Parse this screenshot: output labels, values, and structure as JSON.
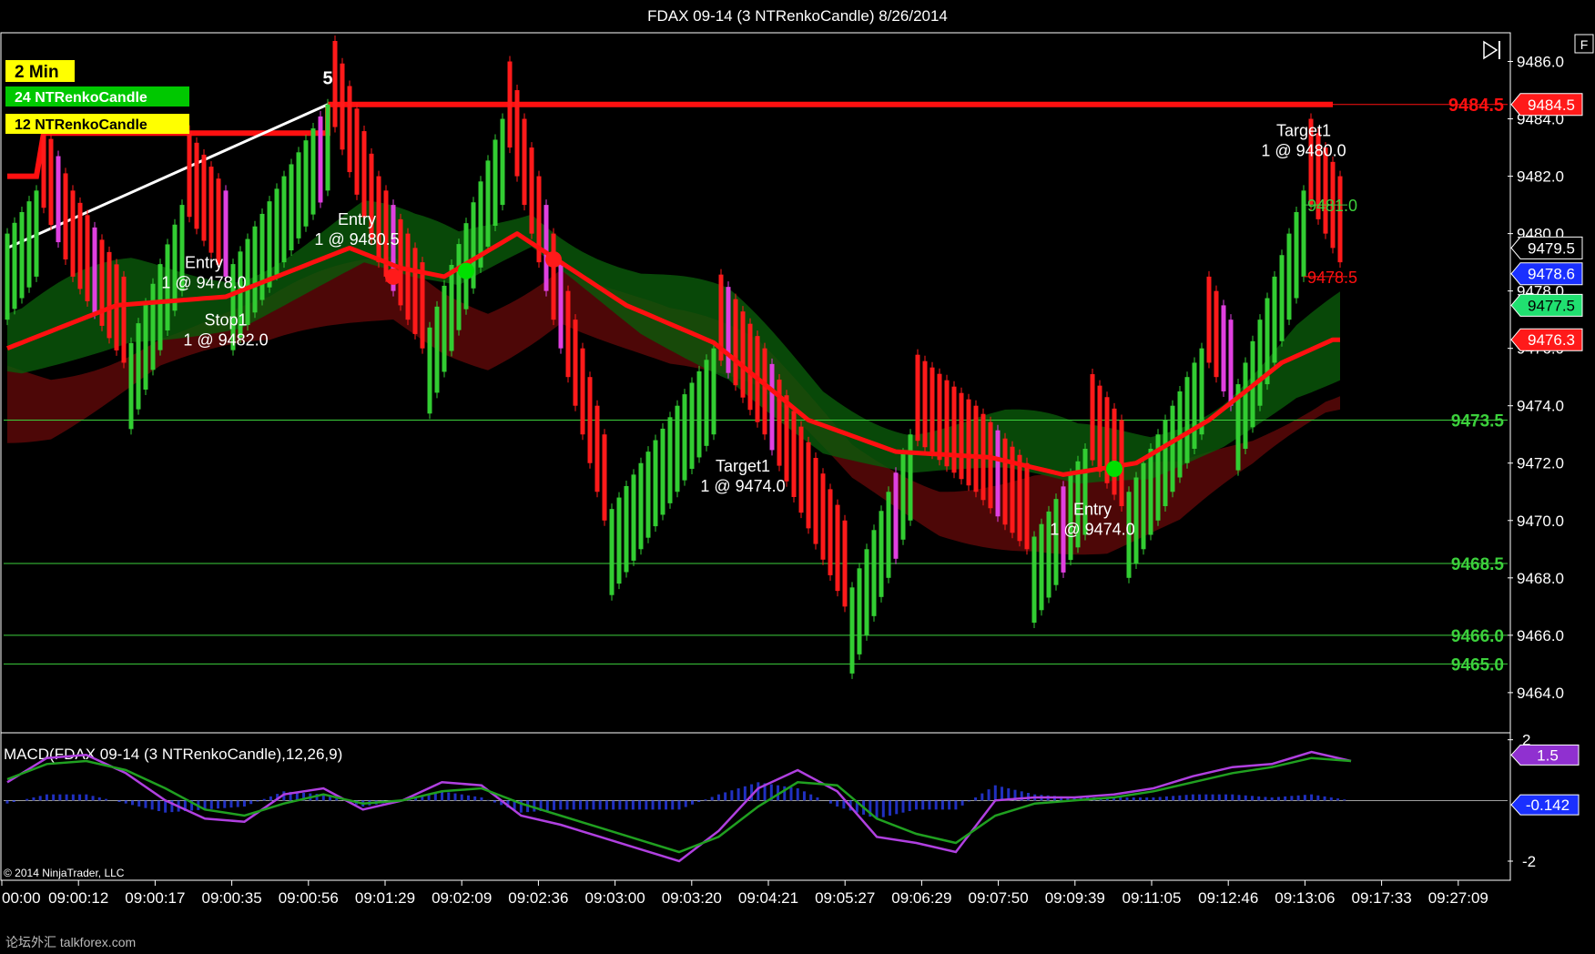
{
  "window": {
    "title": "FDAX 09-14 (3 NTRenkoCandle)  8/26/2014",
    "corner_button": "F",
    "copyright": "© 2014 NinjaTrader, LLC",
    "watermark": "论坛外汇 talkforex.com"
  },
  "legend_boxes": [
    {
      "label": "2 Min",
      "color": "#ffff00"
    },
    {
      "label": "24 NTRenkoCandle",
      "color": "#00c800"
    },
    {
      "label": "12 NTRenkoCandle",
      "color": "#ffff00"
    }
  ],
  "colors": {
    "bull_bar": "#32cd32",
    "bear_bar": "#ff1a1a",
    "magenta_bar": "#e040e0",
    "ma_red": "#ff1010",
    "cloud_green": "#0a5a0a",
    "cloud_red": "#5a0808",
    "macd_line": "#b040e0",
    "signal_line": "#20a020",
    "histogram": "#2030c0",
    "level_green": "#3cd03c"
  },
  "chart_data": [
    {
      "type": "candlestick",
      "title": "FDAX 09-14 (3 NTRenkoCandle)  8/26/2014",
      "ylim": [
        9462.6,
        9487.0
      ],
      "y_ticks": [
        "9486.0",
        "9484.0",
        "9482.0",
        "9480.0",
        "9478.0",
        "9476.0",
        "9474.0",
        "9472.0",
        "9470.0",
        "9468.0",
        "9466.0",
        "9464.0"
      ],
      "x_tick_labels": [
        "00:00",
        "09:00:12",
        "09:00:17",
        "09:00:35",
        "09:00:56",
        "09:01:29",
        "09:02:09",
        "09:02:36",
        "09:03:00",
        "09:03:20",
        "09:04:21",
        "09:05:27",
        "09:06:29",
        "09:07:50",
        "09:09:39",
        "09:11:05",
        "09:12:46",
        "09:13:06",
        "09:17:33",
        "09:27:09"
      ],
      "price_path": [
        {
          "x": 0,
          "y": 9480.0
        },
        {
          "x": 4,
          "y": 9481.5
        },
        {
          "x": 9,
          "y": 9478.5
        },
        {
          "x": 16,
          "y": 9475.5
        },
        {
          "x": 24,
          "y": 9481.0
        },
        {
          "x": 30,
          "y": 9478.5
        },
        {
          "x": 38,
          "y": 9482.0
        },
        {
          "x": 44,
          "y": 9484.5
        },
        {
          "x": 51,
          "y": 9479.0
        },
        {
          "x": 57,
          "y": 9476.0
        },
        {
          "x": 68,
          "y": 9484.0
        },
        {
          "x": 82,
          "y": 9470.0
        },
        {
          "x": 97,
          "y": 9476.0
        },
        {
          "x": 104,
          "y": 9473.0
        },
        {
          "x": 115,
          "y": 9467.0
        },
        {
          "x": 124,
          "y": 9473.0
        },
        {
          "x": 133,
          "y": 9471.0
        },
        {
          "x": 140,
          "y": 9469.0
        },
        {
          "x": 148,
          "y": 9472.5
        },
        {
          "x": 153,
          "y": 9470.5
        },
        {
          "x": 164,
          "y": 9476.0
        },
        {
          "x": 168,
          "y": 9474.0
        },
        {
          "x": 178,
          "y": 9481.5
        },
        {
          "x": 183,
          "y": 9479.0
        }
      ],
      "moving_average": [
        {
          "x": 0,
          "y": 9476.0
        },
        {
          "x": 15,
          "y": 9477.5
        },
        {
          "x": 30,
          "y": 9477.8
        },
        {
          "x": 47,
          "y": 9479.5
        },
        {
          "x": 54,
          "y": 9478.8
        },
        {
          "x": 60,
          "y": 9478.5
        },
        {
          "x": 70,
          "y": 9480.0
        },
        {
          "x": 85,
          "y": 9477.5
        },
        {
          "x": 97,
          "y": 9476.2
        },
        {
          "x": 110,
          "y": 9473.5
        },
        {
          "x": 122,
          "y": 9472.4
        },
        {
          "x": 135,
          "y": 9472.2
        },
        {
          "x": 145,
          "y": 9471.6
        },
        {
          "x": 155,
          "y": 9472.0
        },
        {
          "x": 165,
          "y": 9473.5
        },
        {
          "x": 175,
          "y": 9475.5
        },
        {
          "x": 182,
          "y": 9476.3
        }
      ],
      "trend_line": [
        {
          "x": 0,
          "y": 9479.5
        },
        {
          "x": 44,
          "y": 9484.5
        }
      ],
      "resistance_line": {
        "y": 9484.5,
        "x_from": 44,
        "x_to": 182
      },
      "step_line": [
        {
          "x": 0,
          "y": 9482.0
        },
        {
          "x": 4,
          "y": 9482.0
        },
        {
          "x": 5,
          "y": 9483.5
        },
        {
          "x": 44,
          "y": 9483.5
        },
        {
          "x": 44,
          "y": 9484.5
        }
      ],
      "swing_dots": [
        {
          "x": 53,
          "y": 9478.5,
          "color": "#ff1a1a"
        },
        {
          "x": 63,
          "y": 9478.7,
          "color": "#00e000"
        },
        {
          "x": 75,
          "y": 9479.1,
          "color": "#ff1a1a"
        },
        {
          "x": 152,
          "y": 9471.8,
          "color": "#00e000"
        }
      ],
      "levels": [
        {
          "price": 9473.5,
          "label": "9473.5"
        },
        {
          "price": 9468.5,
          "label": "9468.5"
        },
        {
          "price": 9466.0,
          "label": "9466.0"
        },
        {
          "price": 9465.0,
          "label": "9465.0"
        }
      ],
      "resistance_label": "9484.5",
      "axis_markers": [
        {
          "label": "9484.5",
          "price": 9484.5,
          "bg": "#ff1a1a",
          "fg": "#ffffff"
        },
        {
          "label": "9479.5",
          "price": 9479.5,
          "bg": "#000000",
          "fg": "#ffffff"
        },
        {
          "label": "9478.6",
          "price": 9478.6,
          "bg": "#1a30ff",
          "fg": "#ffffff"
        },
        {
          "label": "9477.5",
          "price": 9477.5,
          "bg": "#20e070",
          "fg": "#000000"
        },
        {
          "label": "9476.3",
          "price": 9476.3,
          "bg": "#ff1a1a",
          "fg": "#ffffff"
        }
      ],
      "target_level": {
        "label": "9481.0",
        "price": 9481.0
      },
      "stop_level": {
        "label": "9478.5",
        "price": 9478.5
      },
      "wave_label": {
        "text": "5",
        "x": 44,
        "y": 9485.2
      },
      "trade_annotations": [
        {
          "line1": "Entry",
          "line2": "1 @ 9478.0",
          "x": 27,
          "y": 9478.8
        },
        {
          "line1": "Stop1",
          "line2": "1 @ 9482.0",
          "x": 30,
          "y": 9476.8
        },
        {
          "line1": "Entry",
          "line2": "1 @ 9480.5",
          "x": 48,
          "y": 9480.3
        },
        {
          "line1": "Target1",
          "line2": "1 @ 9480.0",
          "x": 178,
          "y": 9483.4
        },
        {
          "line1": "Target1",
          "line2": "1 @ 9474.0",
          "x": 101,
          "y": 9471.7
        },
        {
          "line1": "Entry",
          "line2": "1 @ 9474.0",
          "x": 149,
          "y": 9470.2
        }
      ]
    },
    {
      "type": "line",
      "title": "MACD(FDAX 09-14 (3 NTRenkoCandle),12,26,9)",
      "ylim": [
        -2.6,
        2.2
      ],
      "y_ticks": [
        "2",
        "-2"
      ],
      "series": [
        {
          "name": "MACD",
          "values": [
            0.6,
            1.4,
            1.5,
            0.9,
            0.0,
            -0.6,
            -0.7,
            0.2,
            0.4,
            -0.3,
            0.0,
            0.6,
            0.5,
            -0.5,
            -0.8,
            -1.2,
            -1.6,
            -2.0,
            -1.0,
            0.4,
            1.0,
            0.3,
            -1.2,
            -1.4,
            -1.7,
            0.0,
            0.1,
            0.1,
            0.2,
            0.4,
            0.8,
            1.1,
            1.2,
            1.6,
            1.3
          ]
        },
        {
          "name": "Signal",
          "values": [
            0.7,
            1.2,
            1.3,
            1.0,
            0.4,
            -0.3,
            -0.5,
            -0.1,
            0.2,
            -0.1,
            0.0,
            0.3,
            0.4,
            -0.1,
            -0.5,
            -0.9,
            -1.3,
            -1.7,
            -1.2,
            -0.2,
            0.6,
            0.5,
            -0.6,
            -1.1,
            -1.4,
            -0.5,
            -0.1,
            0.0,
            0.1,
            0.3,
            0.6,
            0.9,
            1.1,
            1.4,
            1.3
          ]
        },
        {
          "name": "Histogram",
          "values": [
            -0.1,
            0.2,
            0.2,
            -0.1,
            -0.4,
            -0.3,
            -0.2,
            0.3,
            0.2,
            -0.2,
            0.0,
            0.3,
            0.1,
            -0.4,
            -0.3,
            -0.3,
            -0.3,
            -0.3,
            0.2,
            0.6,
            0.4,
            -0.2,
            -0.6,
            -0.3,
            -0.3,
            0.5,
            0.2,
            0.1,
            0.1,
            0.1,
            0.2,
            0.2,
            0.1,
            0.2,
            0.0
          ]
        }
      ],
      "markers": [
        {
          "label": "1.5",
          "value": 1.5,
          "bg": "#9030d0"
        },
        {
          "label": "-0.142",
          "value": -0.142,
          "bg": "#1a30ff"
        }
      ]
    }
  ]
}
